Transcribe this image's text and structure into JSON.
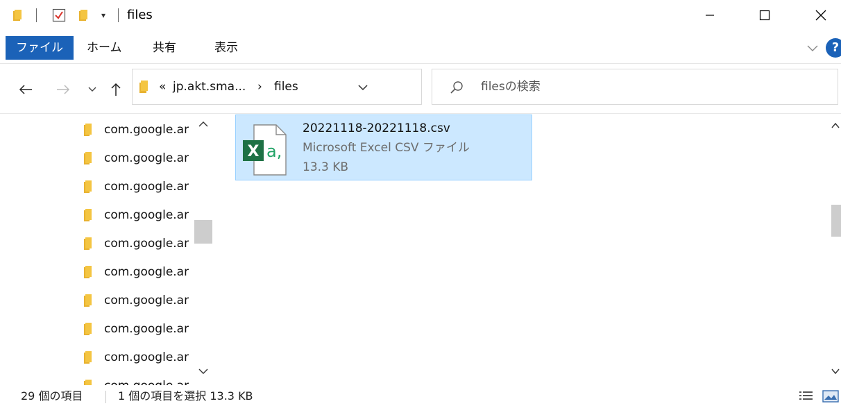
{
  "window": {
    "title": "files"
  },
  "quick_access": {
    "dropdown_glyph": "▾"
  },
  "ribbon": {
    "tabs": [
      {
        "label": "ファイル",
        "active": true
      },
      {
        "label": "ホーム"
      },
      {
        "label": "共有"
      },
      {
        "label": "表示"
      }
    ],
    "help_label": "?"
  },
  "address": {
    "overflow": "«",
    "path": [
      "jp.akt.sma...",
      "files"
    ],
    "separator": "›"
  },
  "search": {
    "placeholder": "filesの検索"
  },
  "nav_pane": {
    "items": [
      {
        "label": "com.google.ar"
      },
      {
        "label": "com.google.ar"
      },
      {
        "label": "com.google.ar"
      },
      {
        "label": "com.google.ar"
      },
      {
        "label": "com.google.ar"
      },
      {
        "label": "com.google.ar"
      },
      {
        "label": "com.google.ar"
      },
      {
        "label": "com.google.ar"
      },
      {
        "label": "com.google.ar"
      },
      {
        "label": "com.google.ar"
      }
    ]
  },
  "files": [
    {
      "name": "20221118-20221118.csv",
      "type": "Microsoft Excel CSV ファイル",
      "size": "13.3 KB",
      "selected": true,
      "icon": "excel-csv-icon"
    }
  ],
  "status": {
    "item_count": "29 個の項目",
    "selection": "1 個の項目を選択  13.3 KB"
  },
  "colors": {
    "accent": "#1b62b8",
    "selection_bg": "#cce8ff",
    "selection_border": "#99d1ff",
    "folder": "#f4c542",
    "excel_green": "#1e7145"
  }
}
